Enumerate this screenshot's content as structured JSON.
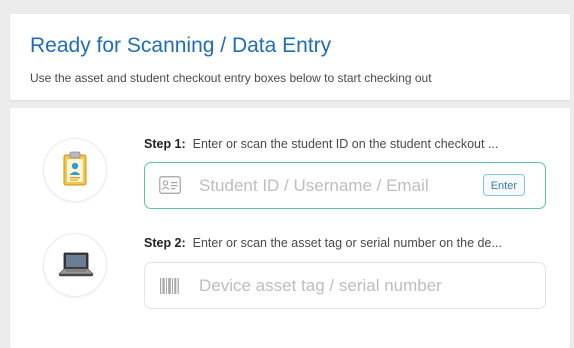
{
  "header": {
    "title": "Ready for Scanning / Data Entry",
    "subtitle": "Use the asset and student checkout entry boxes below to start checking out"
  },
  "steps": [
    {
      "prefix": "Step 1:",
      "text": "Enter or scan the student ID on the student checkout ...",
      "icon": "clipboard-user-icon",
      "input_placeholder": "Student ID / Username / Email",
      "input_value": "",
      "field_icon": "id-card-icon",
      "button_label": "Enter"
    },
    {
      "prefix": "Step 2:",
      "text": "Enter or scan the asset tag or serial number on the de...",
      "icon": "laptop-icon",
      "input_placeholder": "Device asset tag / serial number",
      "input_value": "",
      "field_icon": "barcode-icon"
    }
  ],
  "colors": {
    "title": "#1f6db7",
    "active_border": "#5cc6a3",
    "clipboard_fill": "#f6c548",
    "background": "#ececec"
  }
}
